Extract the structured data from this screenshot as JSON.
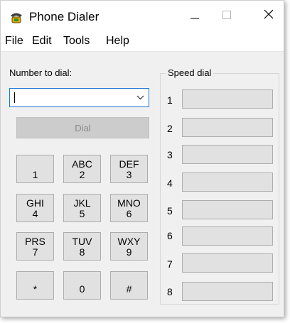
{
  "window": {
    "title": "Phone Dialer"
  },
  "menu": [
    "File",
    "Edit",
    "Tools",
    "Help"
  ],
  "dial": {
    "number_label": "Number to dial:",
    "number_value": "",
    "dial_button": "Dial"
  },
  "keypad": [
    {
      "letters": "",
      "digit": "1"
    },
    {
      "letters": "ABC",
      "digit": "2"
    },
    {
      "letters": "DEF",
      "digit": "3"
    },
    {
      "letters": "GHI",
      "digit": "4"
    },
    {
      "letters": "JKL",
      "digit": "5"
    },
    {
      "letters": "MNO",
      "digit": "6"
    },
    {
      "letters": "PRS",
      "digit": "7"
    },
    {
      "letters": "TUV",
      "digit": "8"
    },
    {
      "letters": "WXY",
      "digit": "9"
    },
    {
      "letters": "",
      "digit": "*"
    },
    {
      "letters": "",
      "digit": "0"
    },
    {
      "letters": "",
      "digit": "#"
    }
  ],
  "speed_dial": {
    "title": "Speed dial",
    "slots": [
      "1",
      "2",
      "3",
      "4",
      "5",
      "6",
      "7",
      "8"
    ]
  },
  "icons": {
    "app": "phone-icon",
    "minimize": "minimize-icon",
    "maximize": "maximize-icon",
    "close": "close-icon",
    "dropdown": "chevron-down-icon"
  }
}
